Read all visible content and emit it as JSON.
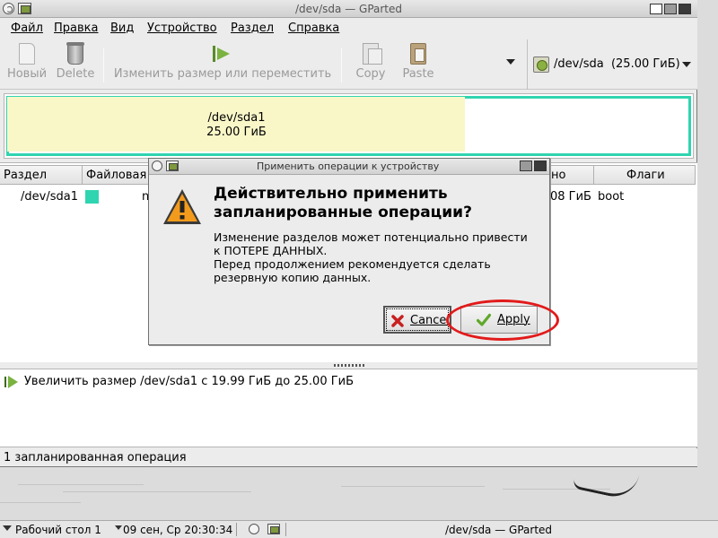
{
  "window": {
    "title": "/dev/sda — GParted"
  },
  "menubar": {
    "items": [
      "Файл",
      "Правка",
      "Вид",
      "Устройство",
      "Раздел",
      "Справка"
    ]
  },
  "toolbar": {
    "new_label": "Новый",
    "delete_label": "Delete",
    "resize_label": "Изменить размер или переместить",
    "copy_label": "Copy",
    "paste_label": "Paste",
    "device_label": "/dev/sda  (25.00 ГиБ)"
  },
  "partition_map": {
    "name": "/dev/sda1",
    "size": "25.00 ГиБ",
    "used_fraction": 0.67,
    "fs_color": "#2fd4b0",
    "used_color": "#f9f7c8"
  },
  "partition_table": {
    "headers": {
      "partition": "Раздел",
      "filesystem": "Файловая",
      "col_no": "но",
      "flags": "Флаги"
    },
    "rows": [
      {
        "partition": "/dev/sda1",
        "fs_partial": "n",
        "used_partial": "08 ГиБ",
        "flags": "boot"
      }
    ]
  },
  "operations": {
    "items": [
      "Увеличить размер /dev/sda1 с 19.99 ГиБ до 25.00 ГиБ"
    ]
  },
  "statusbar": {
    "text": "1 запланированная операция"
  },
  "dialog": {
    "title": "Применить операции к устройству",
    "heading_line1": "Действительно применить",
    "heading_line2": "запланированные операции?",
    "body_line1": "Изменение разделов может потенциально привести",
    "body_line2": "к ПОТЕРЕ ДАННЫХ.",
    "body_line3": "Перед продолжением рекомендуется сделать",
    "body_line4": "резервную копию данных.",
    "cancel_label": "Cancel",
    "apply_label": "Apply",
    "highlight_color": "#e21a1a"
  },
  "taskbar": {
    "workspace": "Рабочий стол 1",
    "clock": "09 сен, Ср 20:30:34",
    "task": "/dev/sda — GParted"
  }
}
